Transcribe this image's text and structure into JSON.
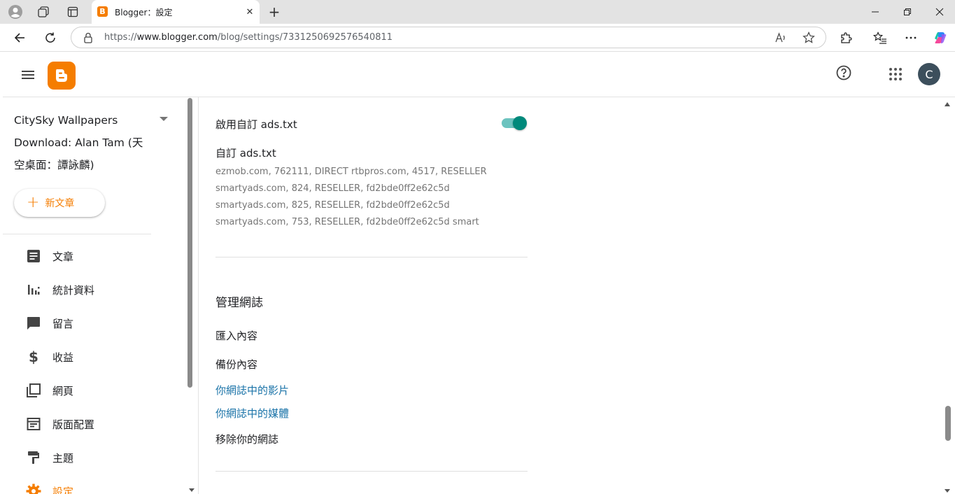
{
  "browser": {
    "tab_title": "Blogger：設定",
    "url_prefix": "https://",
    "url_domain": "www.blogger.com",
    "url_path": "/blog/settings/7331250692576540811",
    "favicon_letter": "B"
  },
  "header": {
    "avatar_letter": "C"
  },
  "sidebar": {
    "blog_title": "CitySky Wallpapers Download: Alan Tam (天空桌面：譚詠麟)",
    "new_post_label": "新文章",
    "items": [
      {
        "label": "文章",
        "icon": "posts-icon"
      },
      {
        "label": "統計資料",
        "icon": "stats-icon"
      },
      {
        "label": "留言",
        "icon": "comments-icon"
      },
      {
        "label": "收益",
        "icon": "earnings-icon"
      },
      {
        "label": "網頁",
        "icon": "pages-icon"
      },
      {
        "label": "版面配置",
        "icon": "layout-icon"
      },
      {
        "label": "主題",
        "icon": "theme-icon"
      },
      {
        "label": "設定",
        "icon": "settings-icon"
      }
    ]
  },
  "main": {
    "enable_ads_label": "啟用自訂 ads.txt",
    "enable_ads_on": true,
    "custom_ads_label": "自訂 ads.txt",
    "custom_ads_value": "ezmob.com, 762111, DIRECT rtbpros.com, 4517, RESELLER smartyads.com, 824, RESELLER, fd2bde0ff2e62c5d smartyads.com, 825, RESELLER, fd2bde0ff2e62c5d smartyads.com, 753, RESELLER, fd2bde0ff2e62c5d smart",
    "manage_title": "管理網誌",
    "import_label": "匯入內容",
    "backup_label": "備份內容",
    "videos_link": "你網誌中的影片",
    "media_link": "你網誌中的媒體",
    "remove_label": "移除你的網誌"
  },
  "colors": {
    "accent": "#f57d00",
    "toggle": "#00897b",
    "link": "#1a73a8"
  }
}
